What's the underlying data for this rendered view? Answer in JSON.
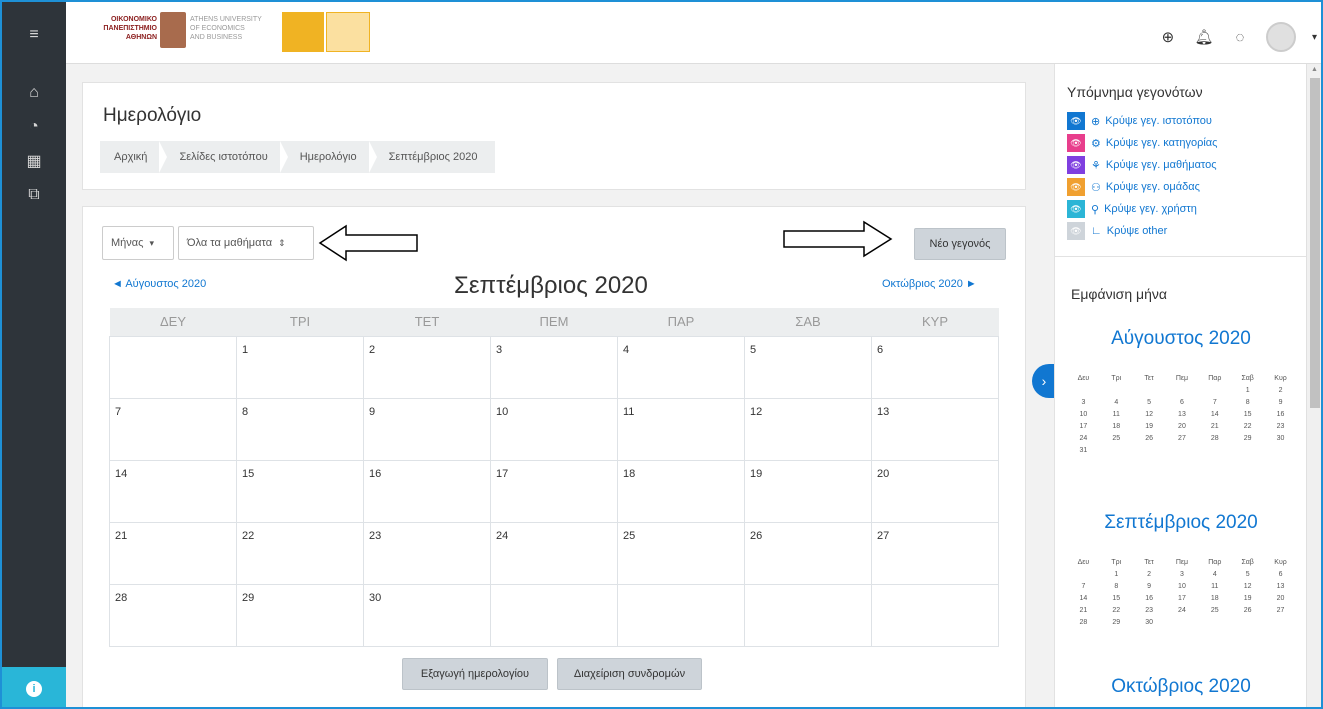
{
  "rail": {
    "items": [
      {
        "icon": "menu-icon",
        "glyph": "≡"
      },
      {
        "icon": "home-icon",
        "glyph": "⌂"
      },
      {
        "icon": "dashboard-icon",
        "glyph": "◔"
      },
      {
        "icon": "calendar-icon",
        "glyph": "▦"
      },
      {
        "icon": "files-icon",
        "glyph": "⧉"
      }
    ],
    "info_glyph": "i"
  },
  "header": {
    "logo_text_gr": [
      "ΟΙΚΟΝΟΜΙΚΟ",
      "ΠΑΝΕΠΙΣΤΗΜΙΟ",
      "ΑΘΗΝΩΝ"
    ],
    "logo_text_en": [
      "ATHENS UNIVERSITY",
      "OF ECONOMICS",
      "AND BUSINESS"
    ]
  },
  "topbar_icons": {
    "globe": "⊕",
    "bell": "🔔︎",
    "chat": "◌",
    "caret": "▾"
  },
  "page": {
    "title": "Ημερολόγιο",
    "breadcrumb": [
      "Αρχική",
      "Σελίδες ιστοτόπου",
      "Ημερολόγιο",
      "Σεπτέμβριος 2020"
    ]
  },
  "calendar": {
    "view_select": "Μήνας",
    "view_caret": "▾",
    "course_select": "Όλα τα μαθήματα",
    "course_caret": "⇕",
    "new_event": "Νέο γεγονός",
    "prev_month": "◄  Αύγουστος 2020",
    "next_month": "Οκτώβριος 2020  ►",
    "month_title": "Σεπτέμβριος 2020",
    "weekdays": [
      "ΔΕΥ",
      "ΤΡΙ",
      "ΤΕΤ",
      "ΠΕΜ",
      "ΠΑΡ",
      "ΣΑΒ",
      "ΚΥΡ"
    ],
    "weeks": [
      [
        "",
        "1",
        "2",
        "3",
        "4",
        "5",
        "6"
      ],
      [
        "7",
        "8",
        "9",
        "10",
        "11",
        "12",
        "13"
      ],
      [
        "14",
        "15",
        "16",
        "17",
        "18",
        "19",
        "20"
      ],
      [
        "21",
        "22",
        "23",
        "24",
        "25",
        "26",
        "27"
      ],
      [
        "28",
        "29",
        "30",
        "",
        "",
        "",
        ""
      ]
    ],
    "export_button": "Εξαγωγή ημερολογίου",
    "subscriptions_button": "Διαχείριση συνδρομών"
  },
  "sidebar": {
    "legend_title": "Υπόμνημα γεγονότων",
    "legend": [
      {
        "label": "Κρύψε γεγ. ιστοτόπου",
        "color": "#1177d1",
        "glyph": "⊕"
      },
      {
        "label": "Κρύψε γεγ. κατηγορίας",
        "color": "#e83e8c",
        "glyph": "⚙"
      },
      {
        "label": "Κρύψε γεγ. μαθήματος",
        "color": "#7f3fe0",
        "glyph": "⚘"
      },
      {
        "label": "Κρύψε γεγ. ομάδας",
        "color": "#f0a030",
        "glyph": "⚇"
      },
      {
        "label": "Κρύψε γεγ. χρήστη",
        "color": "#2bb5d6",
        "glyph": "⚲"
      },
      {
        "label": "Κρύψε other",
        "color": "#ced4da",
        "glyph": "∟"
      }
    ],
    "legend_eye": "👁︎",
    "month_view_title": "Εμφάνιση μήνα",
    "mini_weekdays": [
      "Δευ",
      "Τρι",
      "Τετ",
      "Πεμ",
      "Παρ",
      "Σαβ",
      "Κυρ"
    ],
    "months": [
      {
        "title": "Αύγουστος 2020",
        "weeks": [
          [
            "",
            "",
            "",
            "",
            "",
            "1",
            "2"
          ],
          [
            "3",
            "4",
            "5",
            "6",
            "7",
            "8",
            "9"
          ],
          [
            "10",
            "11",
            "12",
            "13",
            "14",
            "15",
            "16"
          ],
          [
            "17",
            "18",
            "19",
            "20",
            "21",
            "22",
            "23"
          ],
          [
            "24",
            "25",
            "26",
            "27",
            "28",
            "29",
            "30"
          ],
          [
            "31",
            "",
            "",
            "",
            "",
            "",
            ""
          ]
        ]
      },
      {
        "title": "Σεπτέμβριος 2020",
        "weeks": [
          [
            "",
            "1",
            "2",
            "3",
            "4",
            "5",
            "6"
          ],
          [
            "7",
            "8",
            "9",
            "10",
            "11",
            "12",
            "13"
          ],
          [
            "14",
            "15",
            "16",
            "17",
            "18",
            "19",
            "20"
          ],
          [
            "21",
            "22",
            "23",
            "24",
            "25",
            "26",
            "27"
          ],
          [
            "28",
            "29",
            "30",
            "",
            "",
            "",
            ""
          ]
        ]
      },
      {
        "title": "Οκτώβριος 2020"
      }
    ]
  }
}
